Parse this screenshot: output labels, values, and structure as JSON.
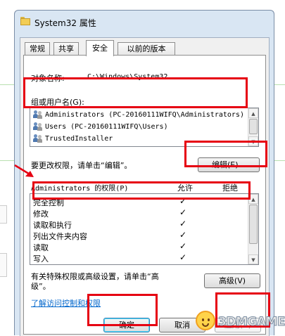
{
  "window": {
    "title": "System32 属性",
    "colors": {
      "frame": "#d9e6f3",
      "highlight": "#e60012",
      "link": "#0066cc"
    }
  },
  "tabs": [
    {
      "label": "常规",
      "active": false
    },
    {
      "label": "共享",
      "active": false
    },
    {
      "label": "安全",
      "active": true
    },
    {
      "label": "以前的版本",
      "active": false
    }
  ],
  "security": {
    "object_name_label": "对象名称:",
    "object_name_value": "C:\\Windows\\System32",
    "groups_label": "组或用户名(G):",
    "groups": [
      {
        "name": "Administrators (PC-20160111WIFQ\\Administrators)",
        "icon": "users-group-icon"
      },
      {
        "name": "Users (PC-20160111WIFQ\\Users)",
        "icon": "users-group-icon"
      },
      {
        "name": "TrustedInstaller",
        "icon": "users-group-icon"
      }
    ],
    "change_hint": "要更改权限，请单击“编辑”。",
    "edit_button": "编辑(E)...",
    "permissions_label": "Administrators 的权限(P)",
    "allow_header": "允许",
    "deny_header": "拒绝",
    "permissions": [
      {
        "name": "完全控制",
        "allow": "✓"
      },
      {
        "name": "修改",
        "allow": "✓"
      },
      {
        "name": "读取和执行",
        "allow": "✓"
      },
      {
        "name": "列出文件夹内容",
        "allow": "✓"
      },
      {
        "name": "读取",
        "allow": "✓"
      },
      {
        "name": "写入",
        "allow": "✓"
      }
    ],
    "advanced_hint_line1": "有关特殊权限或高级设置，请单击“高",
    "advanced_hint_line2": "级”。",
    "advanced_button": "高级(V)",
    "learn_link": "了解访问控制和权限"
  },
  "footer": {
    "ok_button": "确定",
    "cancel_button": "取消",
    "apply_button": "应用(A)"
  },
  "watermark": {
    "text": "3DMGAME",
    "icon": "smiley-logo-icon"
  }
}
